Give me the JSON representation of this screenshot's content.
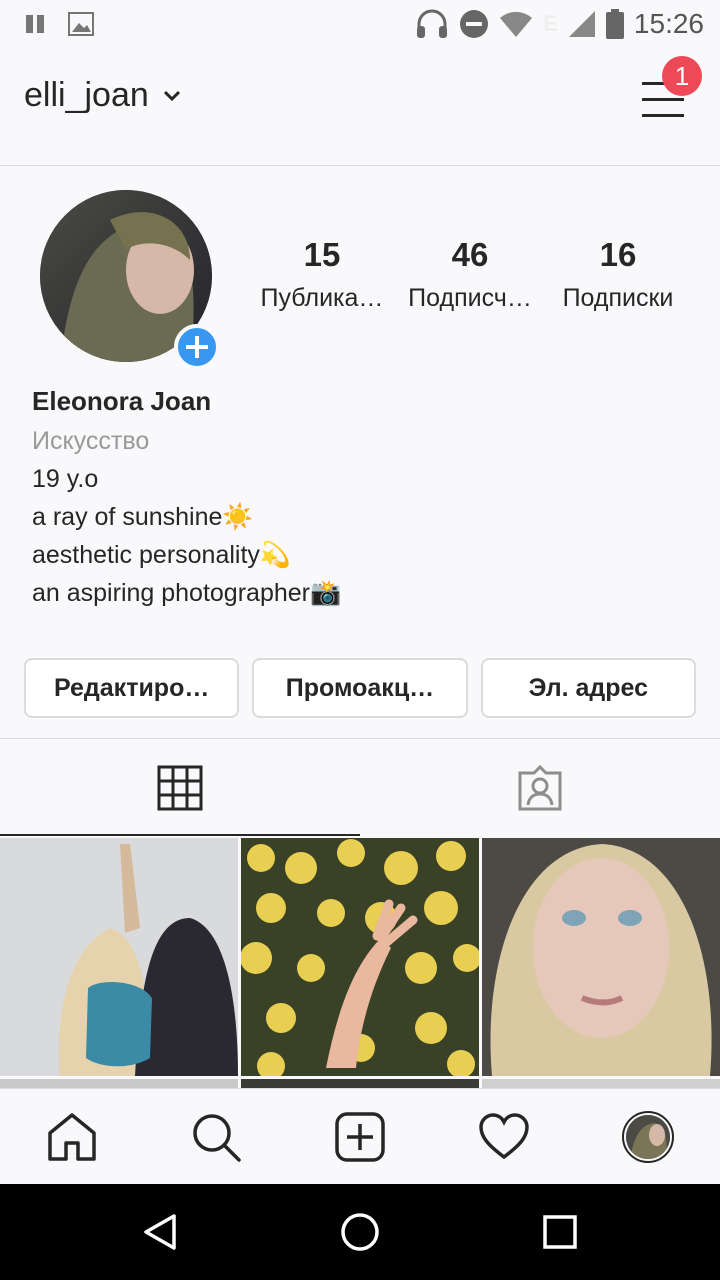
{
  "status_bar": {
    "time": "15:26",
    "network": "E",
    "icons": [
      "pause-icon",
      "image-icon",
      "headset-icon",
      "do-not-disturb-icon",
      "wifi-icon",
      "signal-icon",
      "battery-icon"
    ]
  },
  "header": {
    "username": "elli_joan",
    "notification_count": "1"
  },
  "profile": {
    "stats": [
      {
        "value": "15",
        "label": "Публика…"
      },
      {
        "value": "46",
        "label": "Подписч…"
      },
      {
        "value": "16",
        "label": "Подписки"
      }
    ],
    "name": "Eleonora Joan",
    "category": "Искусство",
    "bio_lines": [
      "19 y.o",
      "a ray of sunshine☀️",
      "aesthetic personality💫",
      "an aspiring photographer📸"
    ]
  },
  "buttons": {
    "edit_label": "Редактиро…",
    "promo_label": "Промоакц…",
    "email_label": "Эл. адрес"
  },
  "colors": {
    "accent_blue": "#3897f0",
    "badge_red": "#ed4956",
    "text": "#262626",
    "secondary_text": "#999999",
    "background": "#f9f8fb"
  }
}
